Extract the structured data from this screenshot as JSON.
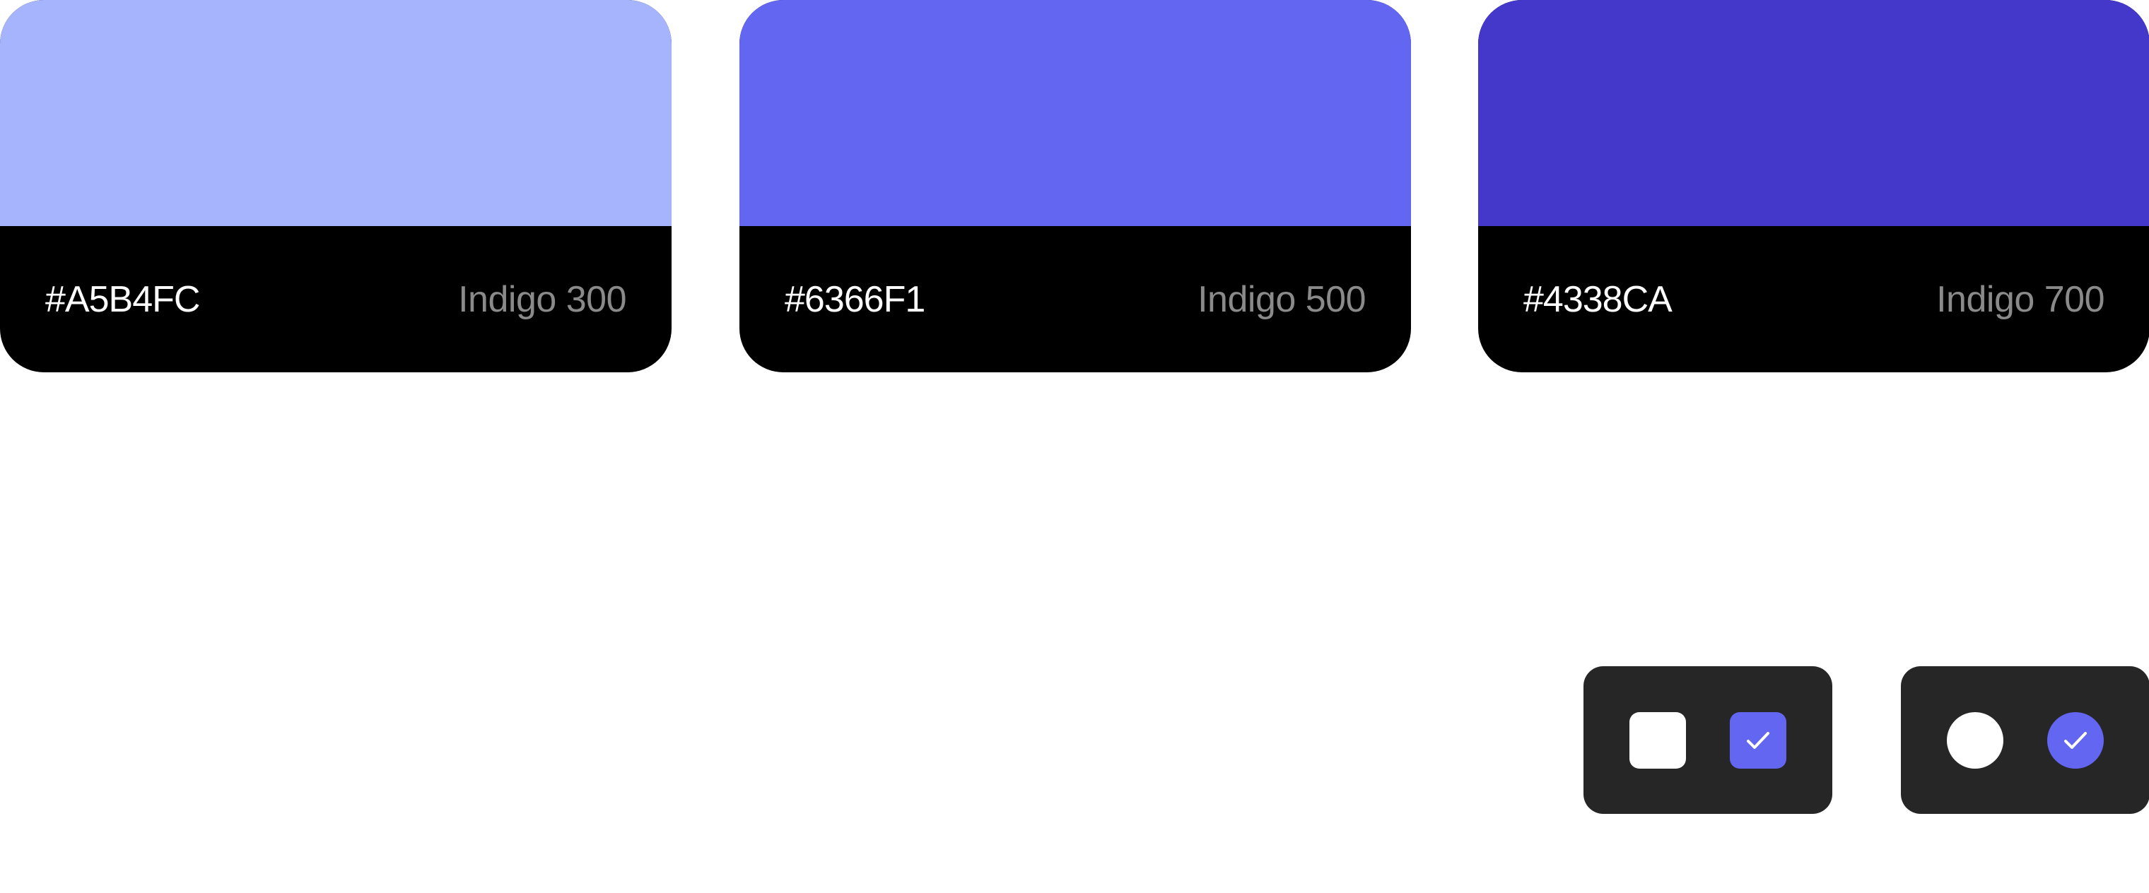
{
  "swatches": [
    {
      "hex": "#A5B4FC",
      "name": "Indigo 300",
      "color": "#A5B4FC"
    },
    {
      "hex": "#6366F1",
      "name": "Indigo 500",
      "color": "#6366F1"
    },
    {
      "hex": "#4338CA",
      "name": "Indigo 700",
      "color": "#4338CA"
    }
  ],
  "controls": {
    "panel_color": "#262626",
    "checkbox": {
      "unchecked_color": "#FFFFFF",
      "checked_color": "#6366F1",
      "check_icon": "checkmark-icon"
    },
    "radio": {
      "unchecked_color": "#FFFFFF",
      "checked_color": "#6366F1",
      "check_icon": "checkmark-icon"
    }
  }
}
